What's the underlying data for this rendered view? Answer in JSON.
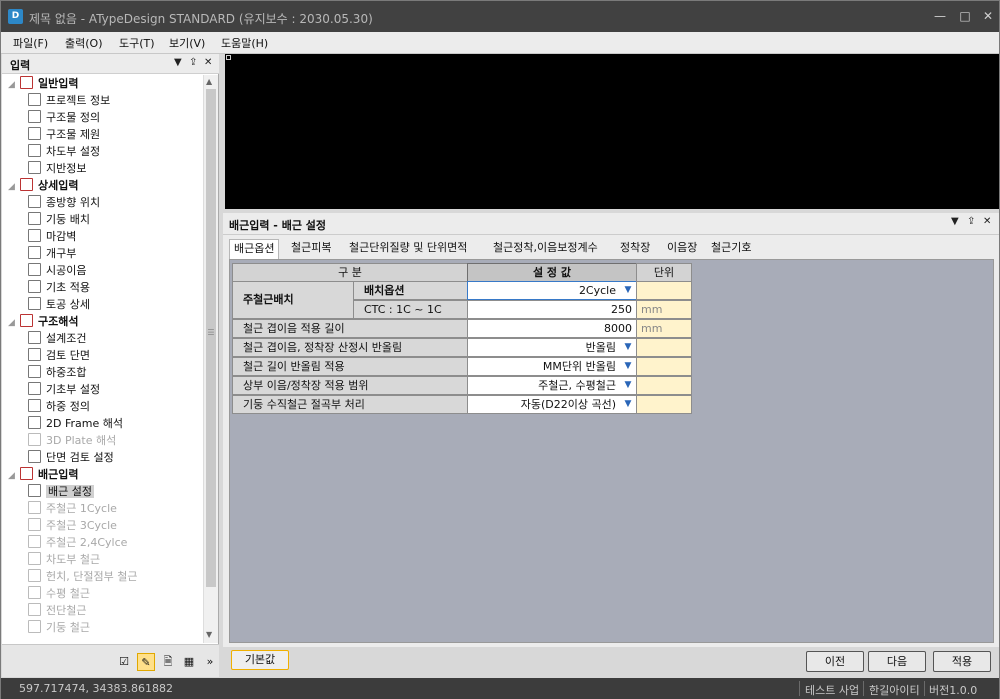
{
  "window": {
    "app_icon": "app-logo-icon",
    "title": "제목 없음 - ATypeDesign STANDARD  (유지보수 : 2030.05.30)",
    "controls": [
      "minimize-icon",
      "maximize-icon",
      "close-icon"
    ]
  },
  "menu": [
    "파일(F)",
    "출력(O)",
    "도구(T)",
    "보기(V)",
    "도움말(H)"
  ],
  "left_panel": {
    "title": "입력",
    "tree": [
      {
        "label": "일반입력",
        "group": true
      },
      {
        "label": "프로젝트 정보"
      },
      {
        "label": "구조물 정의"
      },
      {
        "label": "구조물 제원"
      },
      {
        "label": "차도부 설정"
      },
      {
        "label": "지반정보"
      },
      {
        "label": "상세입력",
        "group": true
      },
      {
        "label": "종방향 위치"
      },
      {
        "label": "기둥 배치"
      },
      {
        "label": "마감벽"
      },
      {
        "label": "개구부"
      },
      {
        "label": "시공이음"
      },
      {
        "label": "기초 적용"
      },
      {
        "label": "토공 상세"
      },
      {
        "label": "구조해석",
        "group": true
      },
      {
        "label": "설계조건"
      },
      {
        "label": "검토 단면"
      },
      {
        "label": "하중조합"
      },
      {
        "label": "기초부 설정"
      },
      {
        "label": "하중 정의"
      },
      {
        "label": "2D Frame 해석"
      },
      {
        "label": "3D Plate 해석",
        "disabled": true
      },
      {
        "label": "단면 검토 설정"
      },
      {
        "label": "배근입력",
        "group": true
      },
      {
        "label": "배근 설정",
        "selected": true
      },
      {
        "label": "주철근 1Cycle",
        "disabled": true
      },
      {
        "label": "주철근 3Cycle",
        "disabled": true
      },
      {
        "label": "주철근 2,4Cylce",
        "disabled": true
      },
      {
        "label": "차도부 철근",
        "disabled": true
      },
      {
        "label": "헌치, 단절점부 철근",
        "disabled": true
      },
      {
        "label": "수평 철근",
        "disabled": true
      },
      {
        "label": "전단철근",
        "disabled": true
      },
      {
        "label": "기둥 철근",
        "disabled": true
      }
    ]
  },
  "right_panel": {
    "title": "배근입력 - 배근 설정",
    "tabs": [
      "배근옵션",
      "철근피복",
      "철근단위질량 및 단위면적",
      "철근정착,이음보정계수",
      "정착장",
      "이음장",
      "철근기호"
    ],
    "table": {
      "header": {
        "section": "구          분",
        "value": "설 정 값",
        "unit": "단위"
      },
      "group_label": "주철근배치",
      "rows": [
        {
          "label": "배치옵션",
          "value": "2Cycle",
          "unit": "",
          "dropdown": true
        },
        {
          "label": "CTC : 1C ~ 1C",
          "value": "250",
          "unit": "mm",
          "dropdown": false
        },
        {
          "label": "철근 겹이음 적용 길이",
          "value": "8000",
          "unit": "mm",
          "dropdown": false
        },
        {
          "label": "철근 겹이음, 정착장 산정시 반올림",
          "value": "반올림",
          "unit": "",
          "dropdown": true
        },
        {
          "label": "철근 길이 반올림 적용",
          "value": "MM단위 반올림",
          "unit": "",
          "dropdown": true
        },
        {
          "label": "상부 이음/정착장 적용 범위",
          "value": "주철근, 수평철근",
          "unit": "",
          "dropdown": true
        },
        {
          "label": "기둥 수직철근 절곡부 처리",
          "value": "자동(D22이상 곡선)",
          "unit": "",
          "dropdown": true
        }
      ]
    },
    "buttons": {
      "default": "기본값",
      "prev": "이전",
      "next": "다음",
      "apply": "적용"
    }
  },
  "status": {
    "coords": "597.717474,  34383.861882",
    "project": "테스트 사업",
    "user": "한길아이티",
    "version": "버전1.0.0"
  }
}
